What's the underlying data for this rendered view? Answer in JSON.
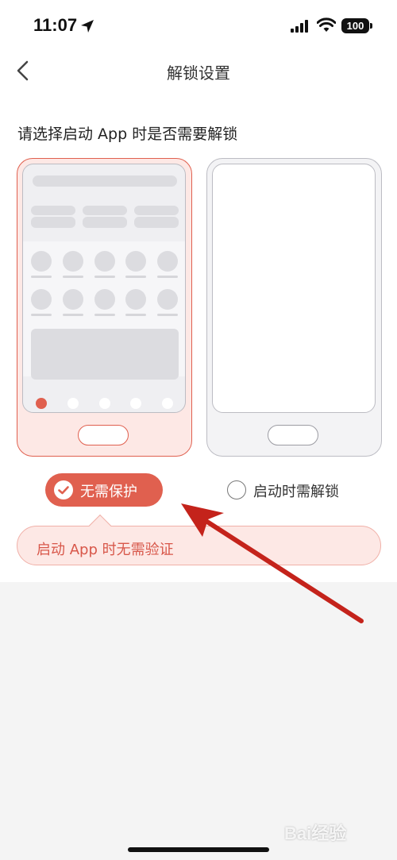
{
  "status_bar": {
    "time": "11:07",
    "battery": "100",
    "icons": [
      "location-arrow-icon",
      "cellular-signal-icon",
      "wifi-icon",
      "battery-icon"
    ]
  },
  "nav": {
    "title": "解锁设置",
    "back_icon": "chevron-left-icon"
  },
  "content": {
    "prompt": "请选择启动 App 时是否需要解锁",
    "options": [
      {
        "label": "无需保护",
        "selected": true
      },
      {
        "label": "启动时需解锁",
        "selected": false
      }
    ],
    "tooltip": "启动 App 时无需验证"
  },
  "watermark": "Bai经验",
  "colors": {
    "accent": "#e0604f",
    "accent_light": "#fde8e5",
    "annotation_arrow": "#c4231b",
    "page_background": "#f4f4f4"
  }
}
